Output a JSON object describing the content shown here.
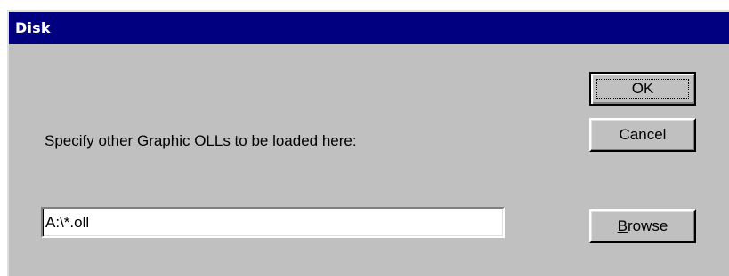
{
  "window": {
    "title": "Disk"
  },
  "prompt": {
    "text": "Specify other Graphic OLLs to be loaded here:"
  },
  "path_field": {
    "value": "A:\\*.oll"
  },
  "buttons": {
    "ok_label": "OK",
    "cancel_label": "Cancel",
    "browse_mnemonic": "B",
    "browse_rest": "rowse"
  },
  "colors": {
    "title_bar": "#000080",
    "face": "#c0c0c0"
  }
}
